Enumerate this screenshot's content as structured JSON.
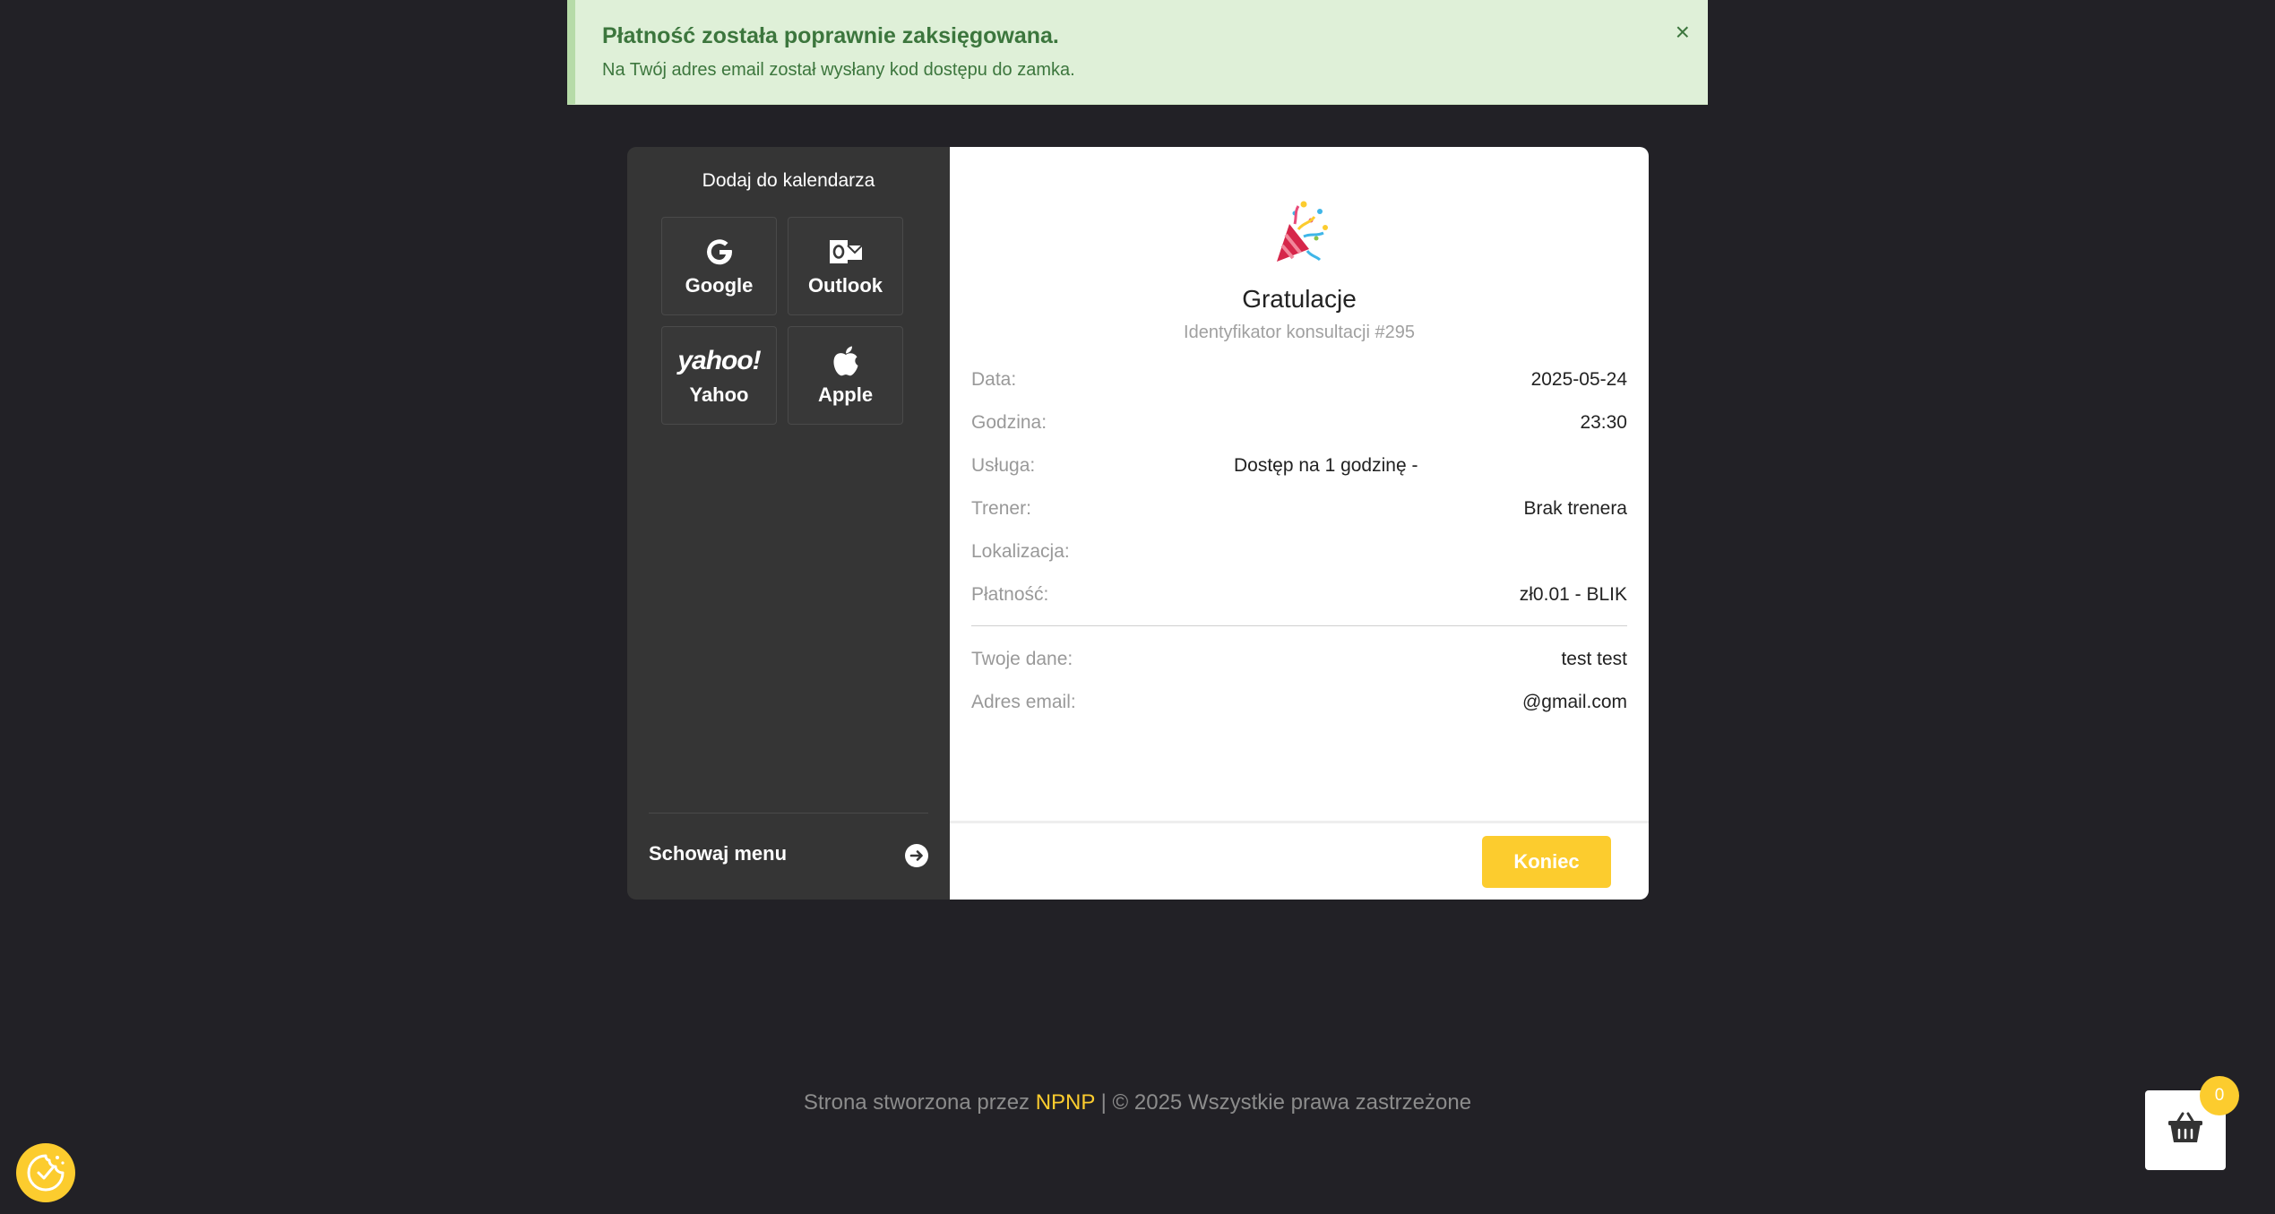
{
  "alert": {
    "title": "Płatność została poprawnie zaksięgowana.",
    "message": "Na Twój adres email został wysłany kod dostępu do zamka.",
    "close_icon": "×"
  },
  "sidebar": {
    "title": "Dodaj do kalendarza",
    "buttons": [
      {
        "label": "Google",
        "icon": "google-icon"
      },
      {
        "label": "Outlook",
        "icon": "outlook-icon"
      },
      {
        "label": "Yahoo",
        "icon": "yahoo-icon",
        "icon_text": "yahoo!"
      },
      {
        "label": "Apple",
        "icon": "apple-icon"
      }
    ],
    "hide_menu_label": "Schowaj menu"
  },
  "summary": {
    "title": "Gratulacje",
    "subtitle": "Identyfikator konsultacji #295",
    "rows": [
      {
        "key": "Data:",
        "value": "2025-05-24"
      },
      {
        "key": "Godzina:",
        "value": "23:30"
      },
      {
        "key": "Usługa:",
        "value": "Dostęp na 1 godzinę -"
      },
      {
        "key": "Trener:",
        "value": "Brak trenera"
      },
      {
        "key": "Lokalizacja:",
        "value": ""
      },
      {
        "key": "Płatność:",
        "value": "zł0.01 - BLIK"
      }
    ],
    "personal": [
      {
        "key": "Twoje dane:",
        "value": "test test"
      },
      {
        "key": "Adres email:",
        "value": "@gmail.com"
      }
    ],
    "end_button": "Koniec"
  },
  "footer": {
    "prefix": "Strona stworzona przez ",
    "brand": "NPNP",
    "suffix": " | © 2025 Wszystkie prawa zastrzeżone"
  },
  "cart": {
    "count": "0"
  },
  "colors": {
    "accent": "#fccc2e",
    "alert_bg": "#dff0d8",
    "alert_text": "#3c763d",
    "page_bg": "#222126",
    "sidebar_bg": "#353535"
  }
}
